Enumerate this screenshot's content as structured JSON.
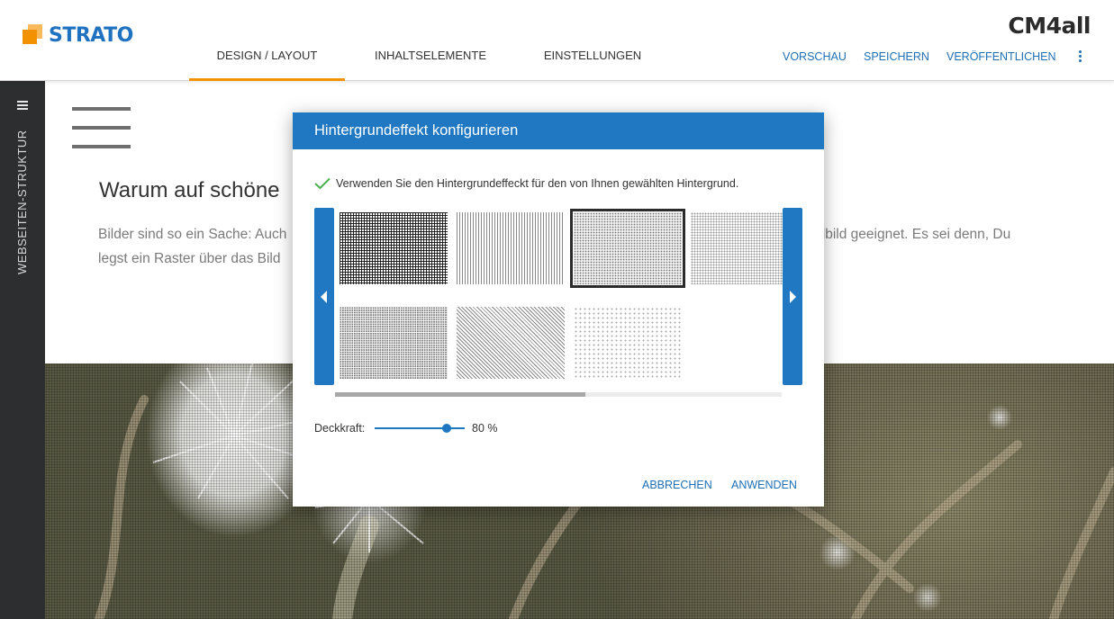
{
  "header": {
    "brand": "STRATO",
    "partner_logo": "CM4all",
    "tabs": [
      {
        "label": "DESIGN / LAYOUT",
        "active": true
      },
      {
        "label": "INHALTSELEMENTE",
        "active": false
      },
      {
        "label": "EINSTELLUNGEN",
        "active": false
      }
    ],
    "actions": {
      "preview": "VORSCHAU",
      "save": "SPEICHERN",
      "publish": "VERÖFFENTLICHEN"
    },
    "more_icon": "more-vertical-icon",
    "accent_color": "#f39200",
    "link_color": "#1f6fb5"
  },
  "sidebar": {
    "label": "WEBSEITEN-STRUKTUR",
    "menu_icon": "menu-icon",
    "background": "#2d2e30"
  },
  "page": {
    "heading": "Warum auf schöne",
    "paragraph_left": "Bilder sind so ein Sache: Auch",
    "paragraph_left_line2": "legst ein Raster über das Bild",
    "paragraph_right": "ndbild geeignet. Es sei denn, Du"
  },
  "dialog": {
    "title": "Hintergrundeffekt konfigurieren",
    "checkbox_label": "Verwenden Sie den Hintergrundeffeckt für den von Ihnen gewählten Hintergrund.",
    "checkbox_checked": true,
    "patterns": [
      {
        "name": "grid-dense",
        "selected": false
      },
      {
        "name": "vertical-lines",
        "selected": false
      },
      {
        "name": "fine-dots",
        "selected": true
      },
      {
        "name": "dots-medium",
        "selected": false
      },
      {
        "name": "dots-dense",
        "selected": false
      },
      {
        "name": "diagonal-lines",
        "selected": false
      },
      {
        "name": "dots-sparse",
        "selected": false
      }
    ],
    "scroll_position": 0.56,
    "opacity_label": "Deckkraft:",
    "opacity_value": 80,
    "opacity_text": "80 %",
    "cancel": "ABBRECHEN",
    "apply": "ANWENDEN",
    "header_color": "#1f78c1"
  }
}
